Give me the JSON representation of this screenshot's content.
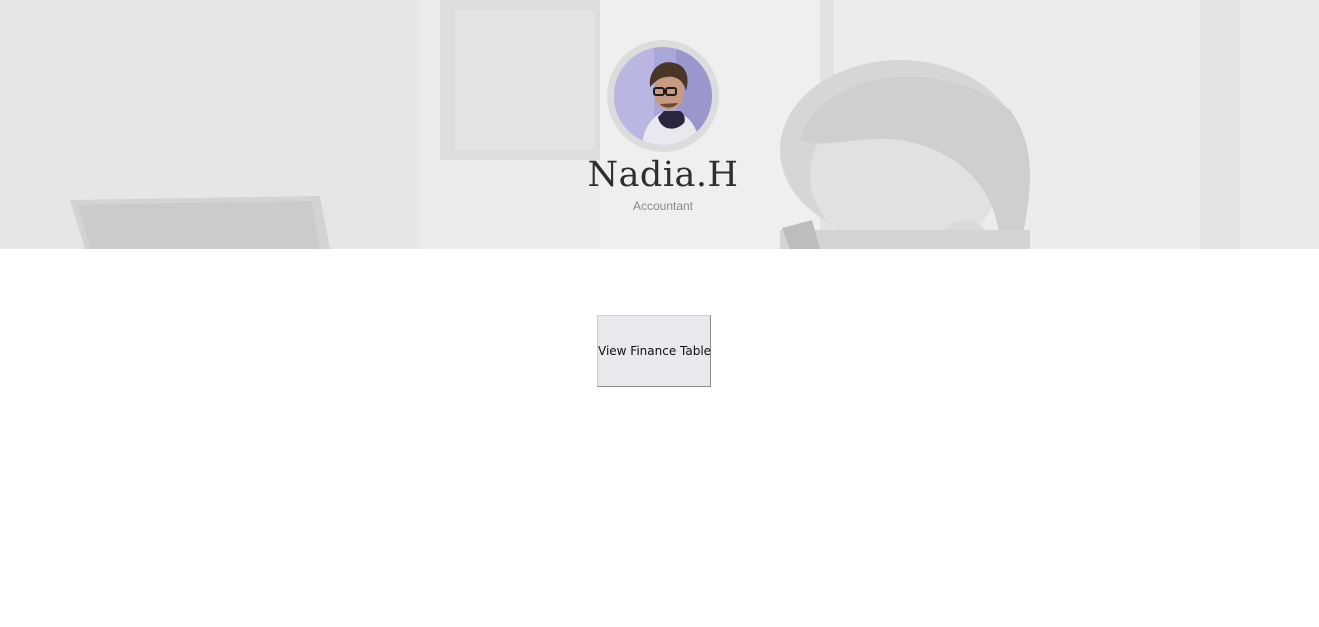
{
  "profile": {
    "name": "Nadia.H",
    "role": "Accountant"
  },
  "actions": {
    "view_finance_table_label": "View Finance Table"
  },
  "colors": {
    "hero_background": "#ececec",
    "name_text": "#2e2e2e",
    "role_text": "#8a8a8a",
    "button_background": "#e9e8ec",
    "avatar_ring": "#dcdcdc"
  }
}
